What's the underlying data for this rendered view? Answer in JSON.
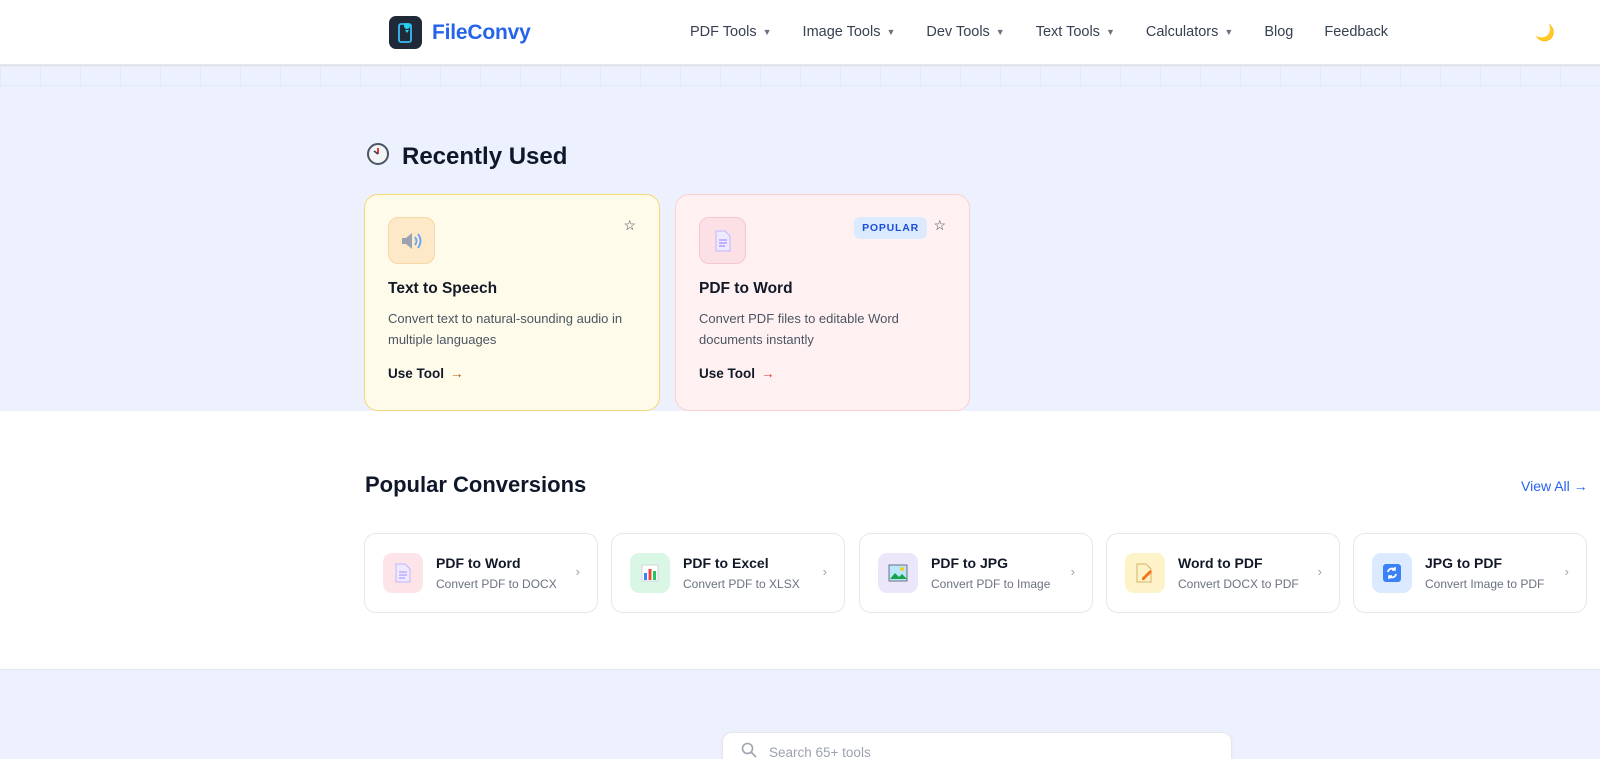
{
  "brand": {
    "name": "FileConvy"
  },
  "nav": {
    "items": [
      {
        "label": "PDF Tools",
        "dropdown": true
      },
      {
        "label": "Image Tools",
        "dropdown": true
      },
      {
        "label": "Dev Tools",
        "dropdown": true
      },
      {
        "label": "Text Tools",
        "dropdown": true
      },
      {
        "label": "Calculators",
        "dropdown": true
      },
      {
        "label": "Blog",
        "dropdown": false
      },
      {
        "label": "Feedback",
        "dropdown": false
      }
    ],
    "caret": "▼",
    "theme_icon": "🌙"
  },
  "recent": {
    "title": "Recently Used",
    "cards": [
      {
        "title": "Text to Speech",
        "desc": "Convert text to natural-sounding audio in multiple languages",
        "link": "Use Tool",
        "arrow": "→",
        "star": "☆",
        "icon": "speaker-icon"
      },
      {
        "title": "PDF to Word",
        "desc": "Convert PDF files to editable Word documents instantly",
        "link": "Use Tool",
        "arrow": "→",
        "star": "☆",
        "badge": "POPULAR",
        "icon": "document-icon"
      }
    ]
  },
  "popular": {
    "title": "Popular Conversions",
    "view_all": "View All →",
    "chevron": "›",
    "items": [
      {
        "title": "PDF to Word",
        "sub": "Convert PDF to DOCX",
        "icon": "document-icon",
        "color": "#fde4e8"
      },
      {
        "title": "PDF to Excel",
        "sub": "Convert PDF to XLSX",
        "icon": "bar-chart-icon",
        "color": "#d9f7e4"
      },
      {
        "title": "PDF to JPG",
        "sub": "Convert PDF to Image",
        "icon": "image-icon",
        "color": "#ece6fb"
      },
      {
        "title": "Word to PDF",
        "sub": "Convert DOCX to PDF",
        "icon": "pencil-doc-icon",
        "color": "#fdf2c8"
      },
      {
        "title": "JPG to PDF",
        "sub": "Convert Image to PDF",
        "icon": "refresh-icon",
        "color": "#dbeafe"
      }
    ]
  },
  "search": {
    "placeholder": "Search 65+ tools"
  }
}
